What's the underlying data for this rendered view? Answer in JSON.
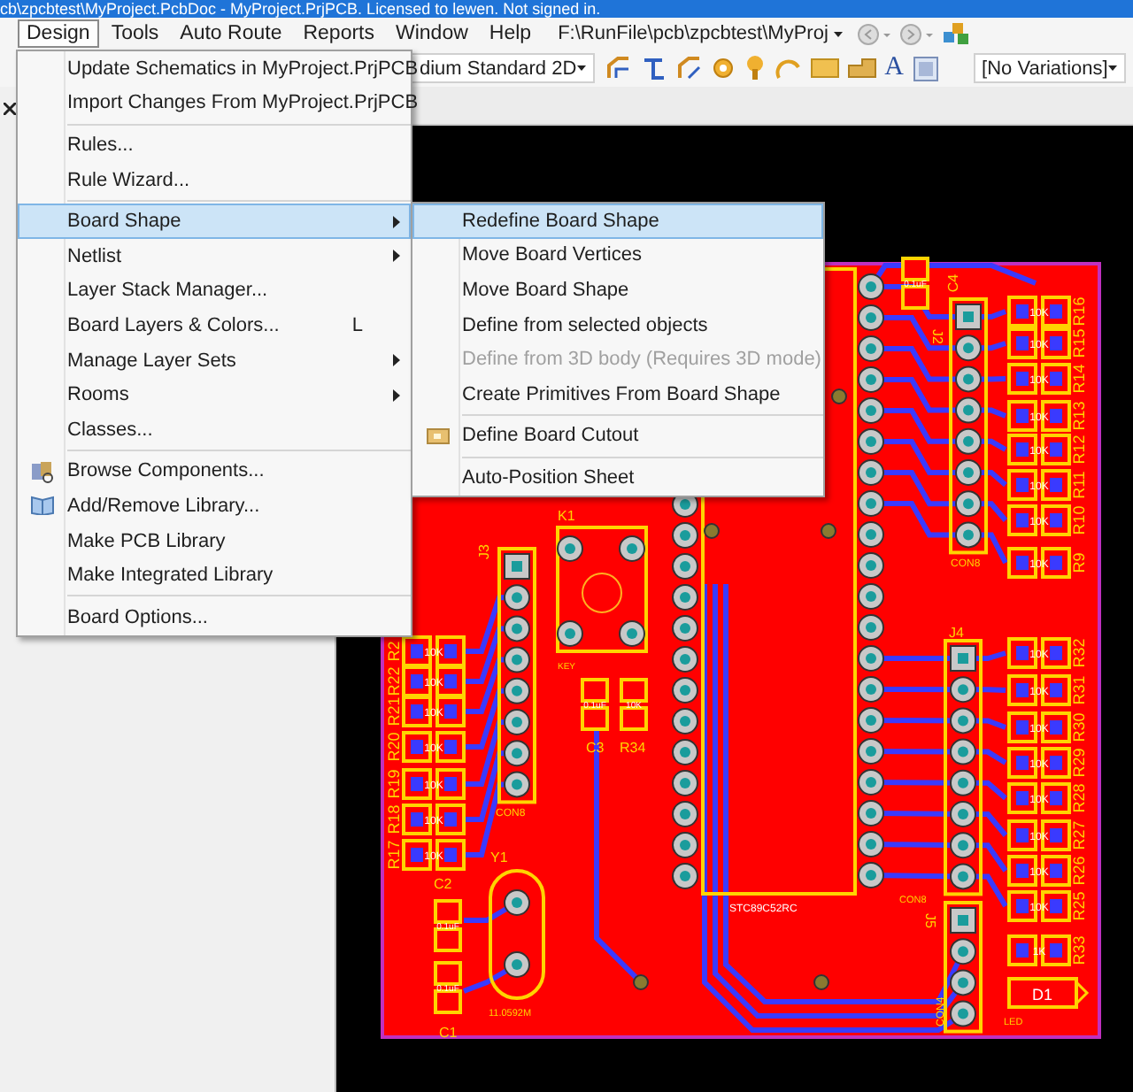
{
  "title_bar": {
    "title": "cb\\zpcbtest\\MyProject.PcbDoc - MyProject.PrjPCB. Licensed to lewen. Not signed in."
  },
  "menu_bar": {
    "items": [
      {
        "label": "Design",
        "selected": true
      },
      {
        "label": "Tools",
        "selected": false
      },
      {
        "label": "Auto Route",
        "selected": false
      },
      {
        "label": "Reports",
        "selected": false
      },
      {
        "label": "Window",
        "selected": false
      },
      {
        "label": "Help",
        "selected": false
      }
    ],
    "path": "F:\\RunFile\\pcb\\zpcbtest\\MyProj"
  },
  "toolbar": {
    "view_combo": "dium Standard 2D",
    "text_tool": "A",
    "variations_combo": "[No Variations]"
  },
  "design_menu": {
    "items": [
      {
        "kind": "item",
        "label": "Update Schematics in MyProject.PrjPCB",
        "selected": false,
        "submenu": false
      },
      {
        "kind": "item",
        "label": "Import Changes From MyProject.PrjPCB",
        "selected": false,
        "submenu": false
      },
      {
        "kind": "separator"
      },
      {
        "kind": "item",
        "label": "Rules...",
        "selected": false,
        "submenu": false
      },
      {
        "kind": "item",
        "label": "Rule Wizard...",
        "selected": false,
        "submenu": false
      },
      {
        "kind": "separator"
      },
      {
        "kind": "item",
        "label": "Board Shape",
        "selected": true,
        "submenu": true
      },
      {
        "kind": "item",
        "label": "Netlist",
        "selected": false,
        "submenu": true
      },
      {
        "kind": "item",
        "label": "Layer Stack Manager...",
        "selected": false,
        "submenu": false
      },
      {
        "kind": "item",
        "label": "Board Layers & Colors...",
        "selected": false,
        "submenu": false,
        "shortcut": "L"
      },
      {
        "kind": "item",
        "label": "Manage Layer Sets",
        "selected": false,
        "submenu": true
      },
      {
        "kind": "item",
        "label": "Rooms",
        "selected": false,
        "submenu": true
      },
      {
        "kind": "item",
        "label": "Classes...",
        "selected": false,
        "submenu": false
      },
      {
        "kind": "separator"
      },
      {
        "kind": "item",
        "label": "Browse Components...",
        "selected": false,
        "submenu": false
      },
      {
        "kind": "item",
        "label": "Add/Remove Library...",
        "selected": false,
        "submenu": false
      },
      {
        "kind": "item",
        "label": "Make PCB Library",
        "selected": false,
        "submenu": false
      },
      {
        "kind": "item",
        "label": "Make Integrated Library",
        "selected": false,
        "submenu": false
      },
      {
        "kind": "separator"
      },
      {
        "kind": "item",
        "label": "Board Options...",
        "selected": false,
        "submenu": false
      }
    ]
  },
  "board_shape_menu": {
    "items": [
      {
        "kind": "item",
        "label": "Redefine Board Shape",
        "selected": true,
        "disabled": false
      },
      {
        "kind": "item",
        "label": "Move Board Vertices",
        "selected": false,
        "disabled": false
      },
      {
        "kind": "item",
        "label": "Move Board Shape",
        "selected": false,
        "disabled": false
      },
      {
        "kind": "item",
        "label": "Define from selected objects",
        "selected": false,
        "disabled": false
      },
      {
        "kind": "item",
        "label": "Define from 3D body (Requires 3D mode)",
        "selected": false,
        "disabled": true
      },
      {
        "kind": "item",
        "label": "Create Primitives From Board Shape",
        "selected": false,
        "disabled": false
      },
      {
        "kind": "separator"
      },
      {
        "kind": "item",
        "label": "Define Board Cutout",
        "selected": false,
        "disabled": false
      },
      {
        "kind": "separator"
      },
      {
        "kind": "item",
        "label": "Auto-Position Sheet",
        "selected": false,
        "disabled": false
      }
    ]
  },
  "pcb": {
    "resistors_upper_right": [
      {
        "ref": "R16",
        "value": "10K"
      },
      {
        "ref": "R15",
        "value": "10K"
      },
      {
        "ref": "R14",
        "value": "10K"
      },
      {
        "ref": "R13",
        "value": "10K"
      },
      {
        "ref": "R12",
        "value": "10K"
      },
      {
        "ref": "R11",
        "value": "10K"
      },
      {
        "ref": "R10",
        "value": "10K"
      },
      {
        "ref": "R9",
        "value": "10K"
      }
    ],
    "resistors_lower_right": [
      {
        "ref": "R32",
        "value": "10K"
      },
      {
        "ref": "R31",
        "value": "10K"
      },
      {
        "ref": "R30",
        "value": "10K"
      },
      {
        "ref": "R29",
        "value": "10K"
      },
      {
        "ref": "R28",
        "value": "10K"
      },
      {
        "ref": "R27",
        "value": "10K"
      },
      {
        "ref": "R26",
        "value": "10K"
      },
      {
        "ref": "R25",
        "value": "10K"
      },
      {
        "ref": "R33",
        "value": "1K"
      }
    ],
    "resistors_left": [
      {
        "ref": "R2",
        "value": "10K"
      },
      {
        "ref": "R22",
        "value": "10K"
      },
      {
        "ref": "R21",
        "value": "10K"
      },
      {
        "ref": "R20",
        "value": "10K"
      },
      {
        "ref": "R19",
        "value": "10K"
      },
      {
        "ref": "R18",
        "value": "10K"
      },
      {
        "ref": "R17",
        "value": "10K"
      }
    ],
    "headers": [
      {
        "ref": "J3",
        "value": "CON8"
      },
      {
        "ref": "J2",
        "value": "CON8"
      },
      {
        "ref": "J4",
        "value": "CON8"
      },
      {
        "ref": "J5",
        "value": "CON4"
      }
    ],
    "switch": {
      "ref": "K1",
      "value": "KEY"
    },
    "capacitors": [
      {
        "ref": "C4",
        "value": "0.1uF"
      },
      {
        "ref": "C3",
        "value": "0.1uF"
      },
      {
        "ref": "C2",
        "value": "0.1uF"
      },
      {
        "ref": "C1",
        "value": "0.1uF"
      }
    ],
    "resistor_single": {
      "ref": "R34",
      "value": "10K"
    },
    "crystal": {
      "ref": "Y1",
      "value": "11.0592M"
    },
    "chip": {
      "value": "STC89C52RC"
    },
    "led": {
      "ref": "D1",
      "value": "LED"
    }
  }
}
